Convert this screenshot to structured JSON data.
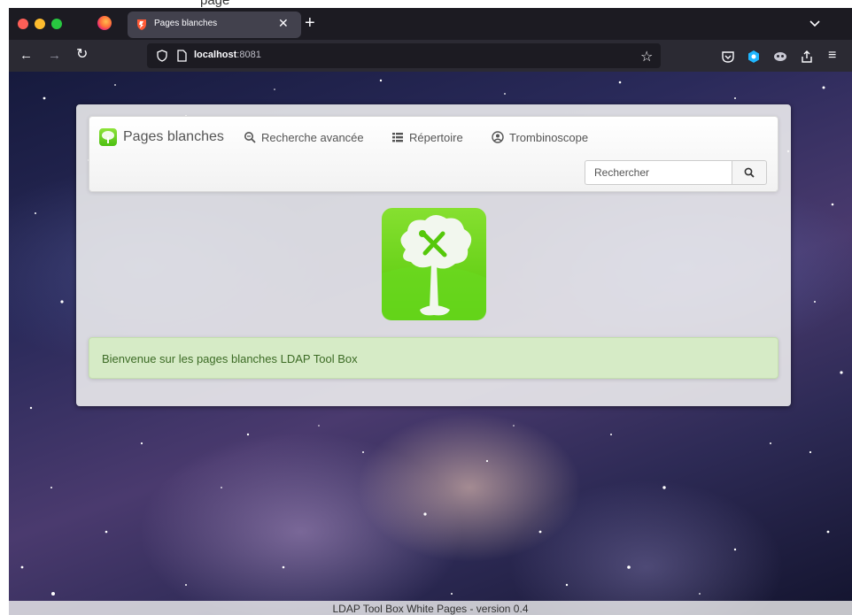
{
  "browser": {
    "tab_title": "Pages blanches",
    "url_host": "localhost",
    "url_port": ":8081"
  },
  "app": {
    "brand": "Pages blanches",
    "nav": {
      "advanced_search": "Recherche avancée",
      "directory": "Répertoire",
      "photo_board": "Trombinoscope"
    },
    "search": {
      "placeholder": "Rechercher"
    },
    "welcome_message": "Bienvenue sur les pages blanches LDAP Tool Box",
    "footer": "LDAP Tool Box White Pages - version 0.4"
  },
  "colors": {
    "accent_green": "#6ad81f",
    "alert_bg": "#d6ebc6",
    "alert_text": "#3c6b25"
  }
}
